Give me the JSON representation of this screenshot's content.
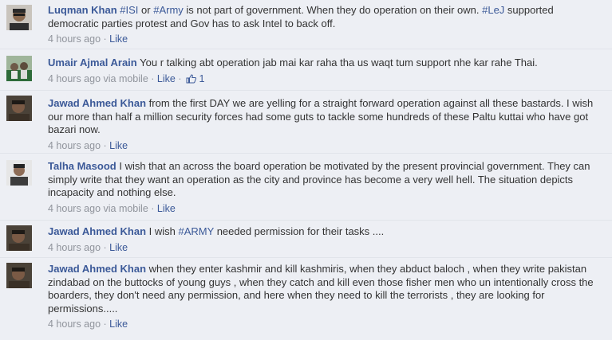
{
  "comments": [
    {
      "author": "Luqman Khan",
      "text_parts": [
        "",
        "#ISI",
        " or ",
        "#Army",
        " is not part of government. When they do operation on their own. ",
        "#LeJ",
        " supported democratic parties protest and Gov has to ask Intel to back off."
      ],
      "time": "4 hours ago",
      "sep": "·",
      "like": "Like"
    },
    {
      "author": "Umair Ajmal Arain",
      "text": "You r talking abt operation jab mai kar raha tha us waqt tum support nhe kar rahe Thai.",
      "time": "4 hours ago via mobile",
      "sep": "·",
      "like": "Like",
      "like_count": "1"
    },
    {
      "author": "Jawad Ahmed Khan",
      "text": "from the first DAY we are yelling for a straight forward operation against all these bastards. I wish our more than half a million security forces had some guts to tackle some hundreds of these Paltu kuttai who have got bazari now.",
      "time": "4 hours ago",
      "sep": "·",
      "like": "Like"
    },
    {
      "author": "Talha Masood",
      "text": "I wish that an across the board operation be motivated by the present provincial government. They can simply write that they want an operation as the city and province has become a very well hell. The situation depicts incapacity and nothing else.",
      "time": "4 hours ago via mobile",
      "sep": "·",
      "like": "Like"
    },
    {
      "author": "Jawad Ahmed Khan",
      "text_parts": [
        "I wish ",
        "#ARMY",
        " needed permission for their tasks ...."
      ],
      "time": "4 hours ago",
      "sep": "·",
      "like": "Like"
    },
    {
      "author": "Jawad Ahmed Khan",
      "text": "when they enter kashmir and kill kashmiris, when they abduct baloch , when they write pakistan zindabad on the buttocks of young guys , when they catch and kill even those fisher men who un intentionally cross the boarders, they don't need any permission, and here when they need to kill the terrorists , they are looking for permissions.....",
      "time": "4 hours ago",
      "sep": "·",
      "like": "Like"
    }
  ],
  "colors": {
    "link": "#3b5998",
    "meta": "#90949c",
    "background": "#edeff4"
  },
  "icons": {
    "like_count": "thumbs-up-icon"
  }
}
